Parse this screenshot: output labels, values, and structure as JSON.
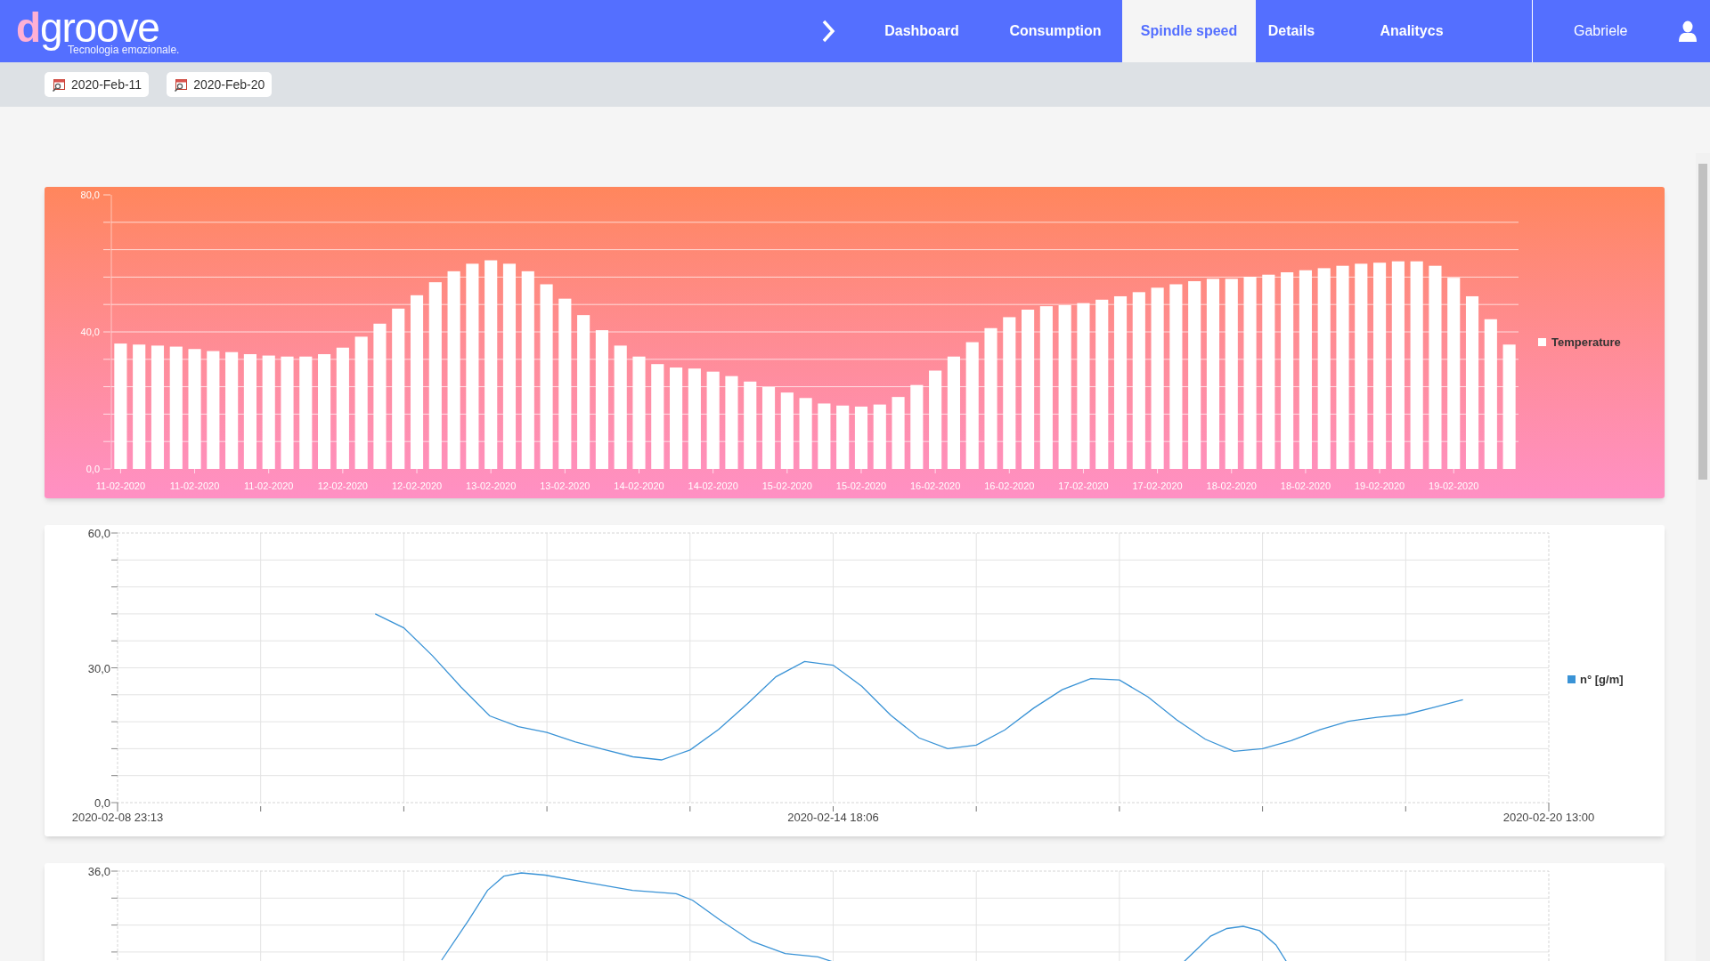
{
  "logo": {
    "mark": "d",
    "word": "groove",
    "tagline": "Tecnologia emozionale."
  },
  "nav": [
    {
      "label": "Dashboard",
      "selected": false
    },
    {
      "label": "Consumption",
      "selected": false
    },
    {
      "label": "Spindle speed",
      "selected": true
    },
    {
      "label": "Details",
      "selected": false
    },
    {
      "label": "Analitycs",
      "selected": false
    }
  ],
  "user": {
    "name": "Gabriele"
  },
  "date_range": [
    "2020-Feb-11",
    "2020-Feb-20"
  ],
  "charts": [
    {
      "chart_data": {
        "type": "bar",
        "categories": [
          "11-02-2020",
          null,
          null,
          null,
          "11-02-2020",
          null,
          null,
          null,
          "11-02-2020",
          null,
          null,
          null,
          "12-02-2020",
          null,
          null,
          null,
          "12-02-2020",
          null,
          null,
          null,
          "13-02-2020",
          null,
          null,
          null,
          "13-02-2020",
          null,
          null,
          null,
          "14-02-2020",
          null,
          null,
          null,
          "14-02-2020",
          null,
          null,
          null,
          "15-02-2020",
          null,
          null,
          null,
          "15-02-2020",
          null,
          null,
          null,
          "16-02-2020",
          null,
          null,
          null,
          "16-02-2020",
          null,
          null,
          null,
          "17-02-2020",
          null,
          null,
          null,
          "17-02-2020",
          null,
          null,
          null,
          "18-02-2020",
          null,
          null,
          null,
          "18-02-2020",
          null,
          null,
          null,
          "19-02-2020",
          null,
          null,
          null,
          "19-02-2020",
          null,
          null,
          null
        ],
        "series": [
          {
            "name": "Temperature",
            "color": "#ffffff",
            "values": [
              36.6,
              36.3,
              36,
              35.7,
              35,
              34.4,
              34.1,
              33.5,
              33.1,
              32.8,
              32.8,
              33.5,
              35.4,
              38.6,
              42.4,
              46.8,
              50.7,
              54.5,
              57.7,
              59.9,
              60.9,
              59.9,
              57.7,
              53.9,
              49.7,
              44.9,
              40.5,
              36,
              32.8,
              30.6,
              29.6,
              29.3,
              28.4,
              27.1,
              25.5,
              23.9,
              22.3,
              20.7,
              19.1,
              18.5,
              18.2,
              18.8,
              21,
              24.5,
              28.7,
              32.8,
              37,
              41.1,
              44.3,
              46.5,
              47.5,
              47.8,
              48.4,
              49.4,
              50.4,
              51.6,
              52.9,
              53.9,
              54.8,
              55.5,
              55.5,
              56.1,
              56.7,
              57.4,
              58,
              58.6,
              59.3,
              59.9,
              60.2,
              60.6,
              60.6,
              59.3,
              55.8,
              50.4,
              43.7,
              36.3
            ]
          }
        ],
        "ylim": [
          0,
          80
        ],
        "grid": true,
        "yticks": [
          {
            "value": 0,
            "label": "0,0"
          },
          {
            "value": 40,
            "label": "40,0"
          },
          {
            "value": 80,
            "label": "80,0"
          }
        ]
      }
    },
    {
      "chart_data": {
        "type": "line",
        "categories": [
          "2020-02-08 23:13",
          null,
          null,
          null,
          null,
          null,
          null,
          null,
          null,
          null,
          null,
          null,
          null,
          null,
          null,
          null,
          null,
          null,
          null,
          null,
          null,
          null,
          null,
          null,
          null,
          "2020-02-14 18:06",
          null,
          null,
          null,
          null,
          null,
          null,
          null,
          null,
          null,
          null,
          null,
          null,
          null,
          null,
          null,
          null,
          null,
          null,
          null,
          null,
          null,
          null,
          null,
          null,
          "2020-02-20 13:00"
        ],
        "series": [
          {
            "name": "n° [g/m]",
            "color": "#3a93d6",
            "values": [
              null,
              null,
              null,
              null,
              null,
              null,
              null,
              null,
              null,
              42.0,
              38.9,
              32.7,
              25.7,
              19.3,
              16.9,
              15.6,
              13.5,
              11.8,
              10.2,
              9.5,
              11.7,
              16.3,
              22.0,
              28.0,
              31.4,
              30.6,
              25.9,
              19.5,
              14.4,
              12.0,
              12.8,
              16.2,
              21.0,
              25.1,
              27.6,
              27.3,
              23.5,
              18.4,
              14.1,
              11.4,
              12.0,
              13.8,
              16.2,
              18.1,
              19.0,
              19.6,
              21.2,
              22.9,
              null,
              null,
              null
            ]
          }
        ],
        "ylim": [
          0,
          60
        ],
        "grid": true,
        "yticks": [
          {
            "value": 0,
            "label": "0,0"
          },
          {
            "value": 30,
            "label": "30,0"
          },
          {
            "value": 60,
            "label": "60,0"
          }
        ]
      }
    },
    {
      "kind": "picture",
      "top_label": "36,0"
    }
  ]
}
